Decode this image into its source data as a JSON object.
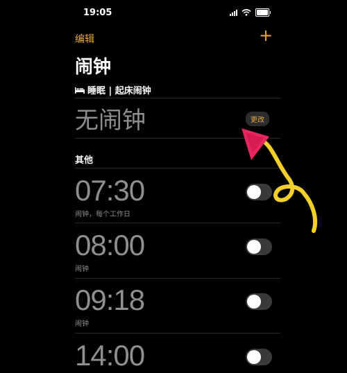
{
  "status": {
    "time": "19:05"
  },
  "nav": {
    "edit_label": "编辑",
    "add_label": "+"
  },
  "title": "闹钟",
  "sleep_section": {
    "header": "睡眠 | 起床闹钟",
    "empty_label": "无闹钟",
    "change_label": "更改"
  },
  "other_section": {
    "header": "其他"
  },
  "alarms": [
    {
      "time": "07:30",
      "label": "闹钟，每个工作日",
      "enabled": false
    },
    {
      "time": "08:00",
      "label": "闹钟",
      "enabled": false
    },
    {
      "time": "09:18",
      "label": "闹钟",
      "enabled": false
    },
    {
      "time": "14:00",
      "label": "",
      "enabled": false
    }
  ],
  "colors": {
    "accent": "#f0a63a",
    "background": "#000000",
    "secondary_text": "#8e8e93",
    "annotation_pink": "#e8265e",
    "annotation_yellow": "#f5d02a"
  },
  "icons": {
    "bed": "bed-icon",
    "signal": "signal-icon",
    "wifi": "wifi-icon",
    "battery": "battery-icon",
    "plus": "plus-icon"
  }
}
